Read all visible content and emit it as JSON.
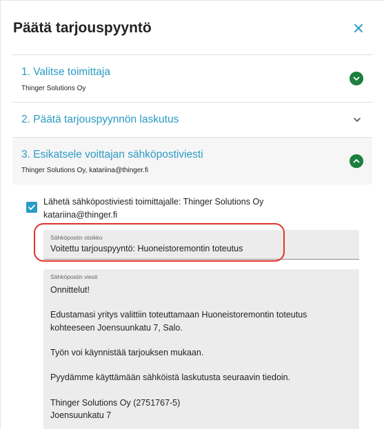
{
  "dialog": {
    "title": "Päätä tarjouspyyntö",
    "close_icon": "close-icon"
  },
  "steps": [
    {
      "title": "1. Valitse toimittaja",
      "subtitle": "Thinger Solutions Oy",
      "state": "completed",
      "icon": "chevron-down-icon"
    },
    {
      "title": "2. Päätä tarjouspyynnön laskutus",
      "state": "collapsed",
      "icon": "chevron-down-icon"
    },
    {
      "title": "3. Esikatsele voittajan sähköpostiviesti",
      "subtitle": "Thinger Solutions Oy, katariina@thinger.fi",
      "state": "expanded",
      "icon": "chevron-up-icon"
    }
  ],
  "email": {
    "send_checkbox_checked": true,
    "send_line1": "Lähetä sähköpostiviesti toimittajalle: Thinger Solutions Oy",
    "send_line2": "katariina@thinger.fi",
    "subject_label": "Sähköpostin otsikko",
    "subject_value": "Voitettu tarjouspyyntö: Huoneistoremontin toteutus",
    "message_label": "Sähköpostin viesti",
    "message_lines": {
      "p1": "Onnittelut!",
      "p2a": "Edustamasi yritys valittiin toteuttamaan Huoneistoremontin toteutus",
      "p2b": "kohteeseen Joensuunkatu 7, Salo.",
      "p3": "Työn voi käynnistää tarjouksen mukaan.",
      "p4": "Pyydämme käyttämään sähköistä laskutusta seuraavin tiedoin.",
      "p5a": "Thinger Solutions Oy (2751767-5)",
      "p5b": "Joensuunkatu 7"
    }
  },
  "colors": {
    "accent": "#2b9bc4",
    "success": "#1b7f3d",
    "highlight": "#e0332a",
    "field_bg": "#ececec"
  }
}
